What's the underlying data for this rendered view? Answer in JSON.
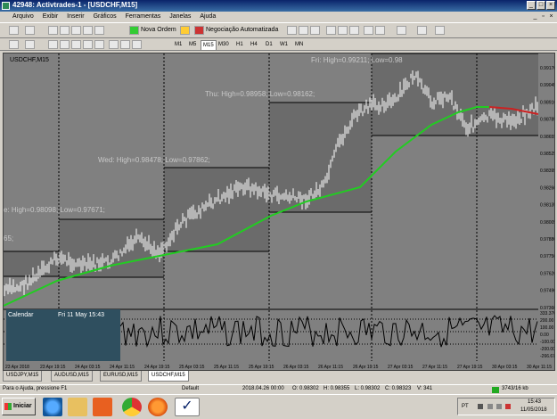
{
  "window": {
    "title": "42948: Activtrades-1 - [USDCHF,M15]",
    "controls": [
      "_",
      "□",
      "×"
    ]
  },
  "menu": {
    "items": [
      "Arquivo",
      "Exibir",
      "Inserir",
      "Gráficos",
      "Ferramentas",
      "Janelas",
      "Ajuda"
    ]
  },
  "toolbar": {
    "new_order": "Nova Ordem",
    "auto_trading": "Negociação Automatizada"
  },
  "timeframes": [
    "M1",
    "M5",
    "M15",
    "M30",
    "H1",
    "H4",
    "D1",
    "W1",
    "MN"
  ],
  "active_timeframe": "M15",
  "chart": {
    "symbol_label": "USDCHF,M15",
    "day_labels": [
      {
        "text": "e: High=0.98098; Low=0.97671;"
      },
      {
        "text": "65;"
      },
      {
        "text": "Wed: High=0.98478; Low=0.97862;"
      },
      {
        "text": "Thu: High=0.98958; Low=0.98162;"
      },
      {
        "text": "Fri: High=0.99211; Low=0.98"
      }
    ],
    "price_ticks": [
      "0.99170",
      "0.99045",
      "0.98910",
      "0.98785",
      "0.98655",
      "0.98525",
      "0.98395",
      "0.98260",
      "0.98135",
      "0.98005",
      "0.97880",
      "0.97750",
      "0.97620",
      "0.97490",
      "0.97360"
    ],
    "indicator_ticks": [
      "333.3709",
      "200.00",
      "100.00",
      "0.00",
      "-100.00",
      "-200.00",
      "-266.6795"
    ],
    "time_ticks": [
      "23 Apr 2018",
      "23 Apr 19:15",
      "24 Apr 03:15",
      "24 Apr 11:15",
      "24 Apr 19:15",
      "25 Apr 03:15",
      "25 Apr 11:15",
      "25 Apr 19:15",
      "26 Apr 03:15",
      "26 Apr 11:15",
      "26 Apr 19:15",
      "27 Apr 03:15",
      "27 Apr 11:15",
      "27 Apr 19:15",
      "30 Apr 03:15",
      "30 Apr 11:15"
    ],
    "colors": {
      "background": "#808080",
      "box_fill": "#6b6b6b",
      "candles": "#ffffff",
      "ma": "#22cc22",
      "ma_recent": "#cc2222",
      "indicator": "#000000"
    }
  },
  "calendar": {
    "title": "Calendar",
    "datetime": "Fri 11 May 15:43"
  },
  "tabs": [
    "USDJPY,M15",
    "AUDUSD,M15",
    "EURUSD,M15",
    "USDCHF,M15"
  ],
  "active_tab": "USDCHF,M15",
  "status": {
    "help": "Para o Ajuda, pressione F1",
    "profile": "Default",
    "datetime": "2018.04.26 00:00",
    "open": "O: 0.98302",
    "high": "H: 0.98355",
    "low": "L: 0.98302",
    "close": "C: 0.98323",
    "volume": "V: 341",
    "traffic": "3743/16 kb"
  },
  "taskbar": {
    "start": "Iniciar",
    "lang": "PT",
    "time": "15:43",
    "date": "11/05/2018",
    "apps": [
      "ie-icon",
      "folder-icon",
      "media-player-icon",
      "chrome-icon",
      "firefox-icon",
      "metatrader-icon"
    ]
  }
}
